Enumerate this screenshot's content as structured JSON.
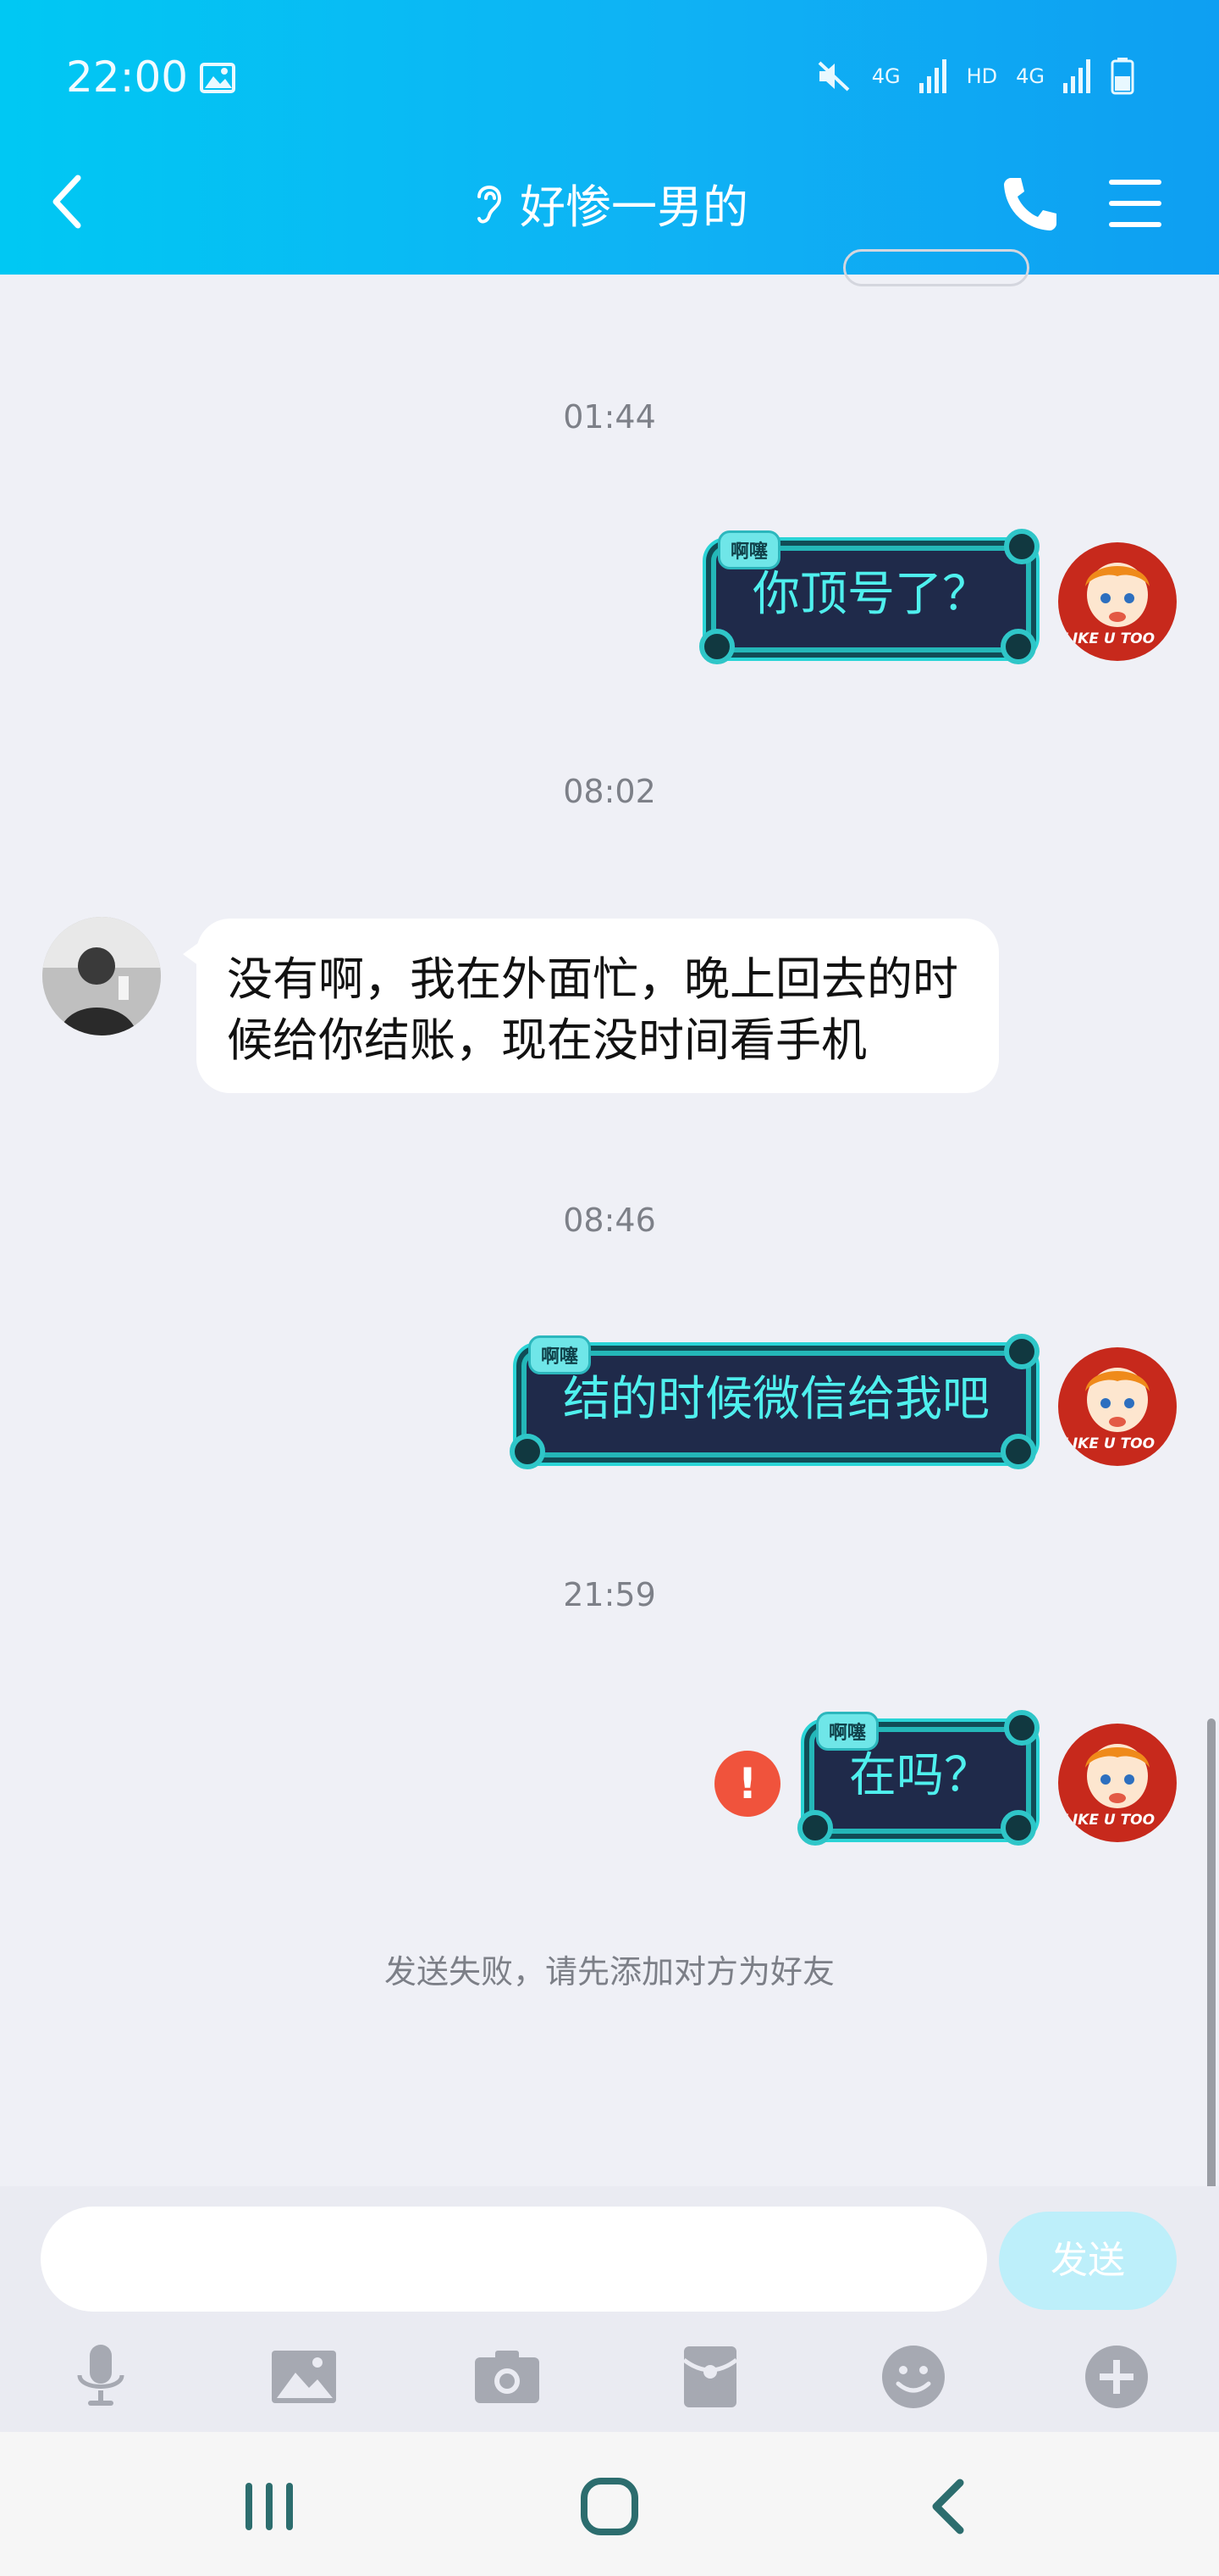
{
  "status_bar": {
    "time": "22:00",
    "network_label_1": "4G",
    "network_label_hd": "HD",
    "network_label_2": "4G"
  },
  "header": {
    "title": "好惨一男的"
  },
  "messages": [
    {
      "time": "01:44",
      "text": "你顶号了？",
      "tag": "啊噻",
      "side": "right"
    },
    {
      "time": "08:02",
      "text": "没有啊，我在外面忙，晚上回去的时候给你结账，现在没时间看手机",
      "side": "left"
    },
    {
      "time": "08:46",
      "text": "结的时候微信给我吧",
      "tag": "啊噻",
      "side": "right"
    },
    {
      "time": "21:59",
      "text": "在吗？",
      "tag": "啊噻",
      "side": "right",
      "error": "!"
    }
  ],
  "avatar_label": "LIKE U TOO",
  "system_note": "发送失败，请先添加对方为好友",
  "input": {
    "send_label": "发送",
    "placeholder": ""
  },
  "toolbar_icons": [
    "microphone-icon",
    "image-icon",
    "camera-icon",
    "red-envelope-icon",
    "emoji-icon",
    "plus-icon"
  ],
  "colors": {
    "header_start": "#00c8f3",
    "header_end": "#0e9ff2",
    "bubble_text": "#4ff0ee",
    "error": "#f0533c",
    "send_btn": "#bdeffa"
  }
}
